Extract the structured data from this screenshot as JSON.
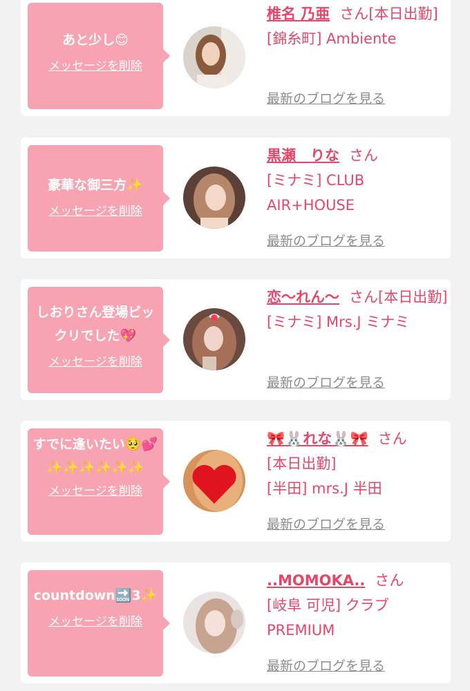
{
  "colors": {
    "bubble": "#f7a3b2",
    "accent": "#e5476b",
    "muted": "#8c8c8c",
    "card": "#ffffff",
    "page": "#f2f2f2"
  },
  "cards": [
    {
      "message": "あと少し😊",
      "delete_label": "メッセージを削除",
      "name": "椎名 乃亜",
      "honorific": "さん",
      "status": "[本日出勤]",
      "shop": "[錦糸町] Ambiente",
      "blog_link": "最新のブログを見る"
    },
    {
      "message": "豪華な御三方✨",
      "delete_label": "メッセージを削除",
      "name": "黒瀬　りな",
      "honorific": "さん",
      "status": "",
      "shop": "[ミナミ] CLUB AIR+HOUSE",
      "blog_link": "最新のブログを見る"
    },
    {
      "message": "しおりさん登場ビックリでした💖",
      "delete_label": "メッセージを削除",
      "name": "恋〜れん〜",
      "honorific": "さん",
      "status": "[本日出勤]",
      "shop": "[ミナミ] Mrs.J ミナミ",
      "blog_link": "最新のブログを見る"
    },
    {
      "message": "すでに逢いたい🥺💕✨✨✨✨✨✨",
      "delete_label": "メッセージを削除",
      "name": "🎀🐰れな🐰🎀",
      "honorific": "さん",
      "status": "[本日出勤]",
      "shop": "[半田] mrs.J 半田",
      "blog_link": "最新のブログを見る"
    },
    {
      "message": "countdown🔜3✨",
      "delete_label": "メッセージを削除",
      "name": "..MOMOKA..",
      "honorific": "さん",
      "status": "",
      "shop": "[岐阜 可児] クラブ PREMIUM",
      "blog_link": "最新のブログを見る"
    }
  ]
}
